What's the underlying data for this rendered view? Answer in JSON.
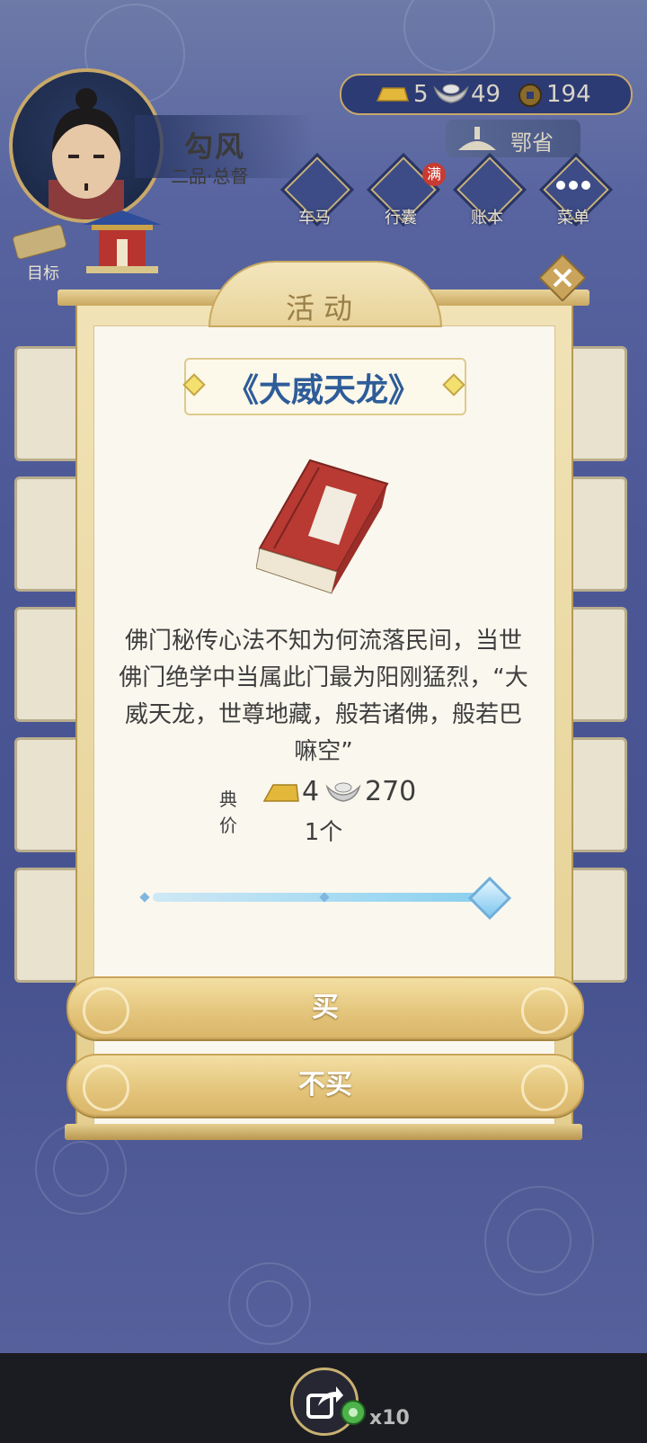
{
  "player": {
    "name": "勾风",
    "rank": "二品·总督"
  },
  "currency": {
    "gold": "5",
    "silver": "49",
    "coins": "194"
  },
  "location": "鄂省",
  "nav": [
    {
      "label": "车马"
    },
    {
      "label": "行囊",
      "badge": "满"
    },
    {
      "label": "账本"
    },
    {
      "label": "菜单"
    }
  ],
  "target_label": "目标",
  "dialog": {
    "title": "活动",
    "item_name": "《大威天龙》",
    "description": "佛门秘传心法不知为何流落民间，当世佛门绝学中当属此门最为阳刚猛烈，“大威天龙，世尊地藏，般若诸佛，般若巴嘛空”",
    "price_label": "典价",
    "price_gold": "4",
    "price_silver": "270",
    "quantity": "1个",
    "slider_value": 1.0,
    "buy_label": "买",
    "decline_label": "不买"
  },
  "share": {
    "count": "x10"
  },
  "colors": {
    "accent_gold": "#e3c47a",
    "title_blue": "#2e5c99",
    "panel": "#faf7ee"
  }
}
